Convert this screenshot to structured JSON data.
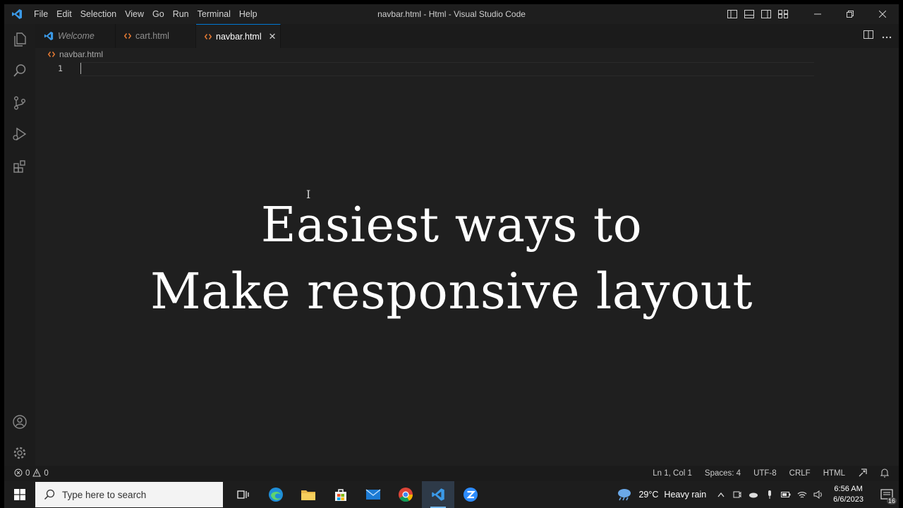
{
  "window": {
    "title": "navbar.html - Html - Visual Studio Code",
    "menu": [
      "File",
      "Edit",
      "Selection",
      "View",
      "Go",
      "Run",
      "Terminal",
      "Help"
    ]
  },
  "tabs": [
    {
      "label": "Welcome",
      "icon": "vscode-icon",
      "italic": true,
      "active": false
    },
    {
      "label": "cart.html",
      "icon": "html-file-icon",
      "active": false
    },
    {
      "label": "navbar.html",
      "icon": "html-file-icon",
      "active": true,
      "close": "✕"
    }
  ],
  "editor": {
    "breadcrumb": "navbar.html",
    "line_number": "1",
    "overlay_line1": "Easiest ways to",
    "overlay_line2": "Make responsive layout"
  },
  "statusbar": {
    "errors": "0",
    "warnings": "0",
    "position": "Ln 1, Col 1",
    "spaces": "Spaces: 4",
    "encoding": "UTF-8",
    "eol": "CRLF",
    "language": "HTML"
  },
  "taskbar": {
    "search_placeholder": "Type here to search",
    "weather_temp": "29°C",
    "weather_desc": "Heavy rain",
    "time": "6:56 AM",
    "date": "6/6/2023",
    "notifications": "16"
  },
  "colors": {
    "accent": "#0078d4",
    "html_icon": "#e37933",
    "vscode_blue": "#3b9ae8"
  }
}
